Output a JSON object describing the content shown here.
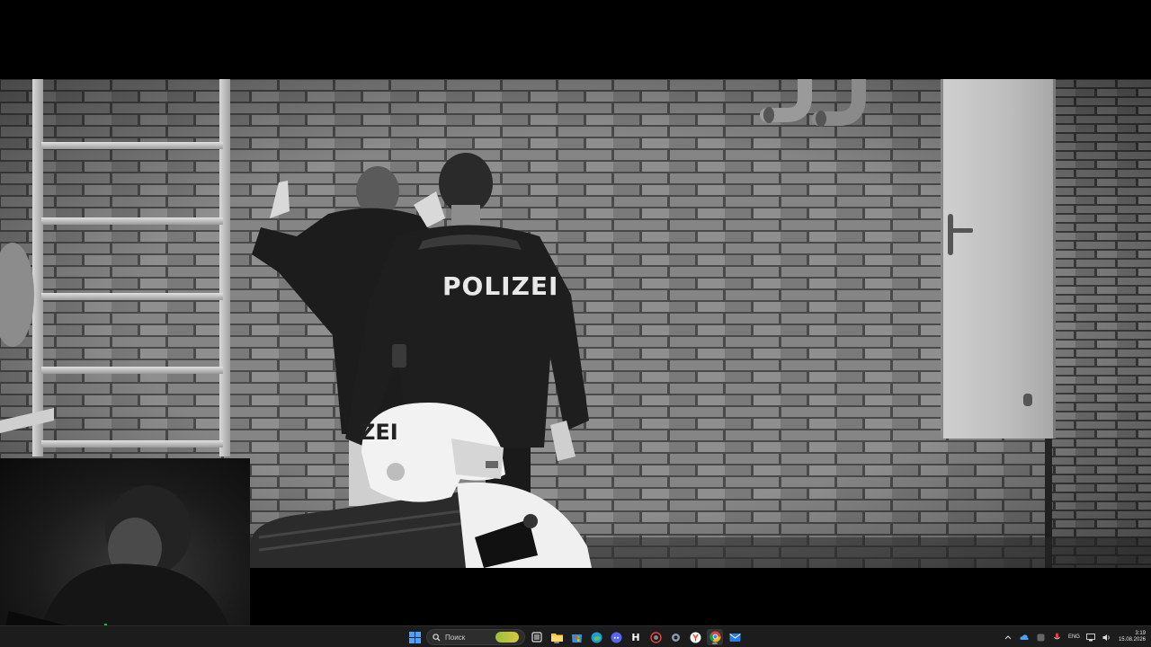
{
  "video": {
    "officer_jacket_text": "POLIZEI",
    "helmet_text": "ZEI"
  },
  "taskbar": {
    "search": {
      "placeholder": "Поиск"
    },
    "apps": [
      {
        "name": "start",
        "icon": "windows-icon"
      },
      {
        "name": "search",
        "icon": "search-icon"
      },
      {
        "name": "task-view",
        "icon": "task-view-icon"
      },
      {
        "name": "file-explorer",
        "icon": "folder-icon"
      },
      {
        "name": "store",
        "icon": "store-icon"
      },
      {
        "name": "edge",
        "icon": "edge-icon"
      },
      {
        "name": "discord",
        "icon": "discord-icon"
      },
      {
        "name": "app-h",
        "icon": "h-letter-icon"
      },
      {
        "name": "app-red",
        "icon": "red-circle-icon"
      },
      {
        "name": "settings",
        "icon": "gear-icon"
      },
      {
        "name": "yandex-browser",
        "icon": "yandex-icon"
      },
      {
        "name": "chrome",
        "icon": "chrome-icon"
      },
      {
        "name": "mail",
        "icon": "mail-icon"
      }
    ],
    "tray": {
      "language": "ENG",
      "time": "3:19",
      "date": "15.08.2026"
    }
  },
  "colors": {
    "taskbar_bg": "#1c1c1c",
    "accent_blue": "#4aa3ff"
  }
}
